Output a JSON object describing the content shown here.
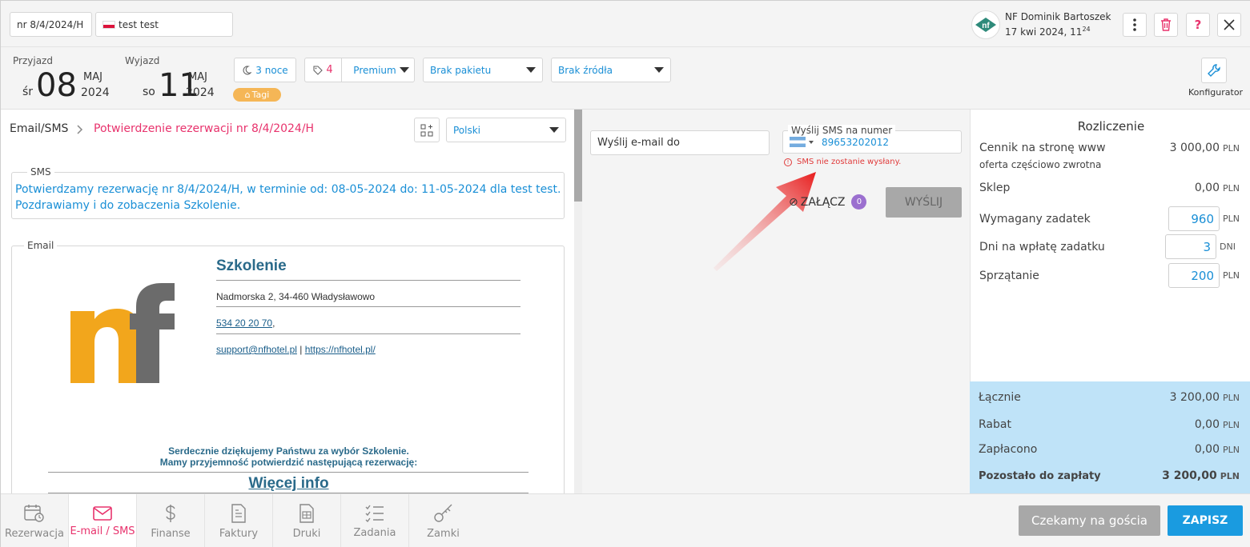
{
  "header": {
    "reservation_no": "nr 8/4/2024/H",
    "guest_name": "test test",
    "user_name": "NF Dominik Bartoszek",
    "user_date": "17 kwi 2024, 11",
    "user_time_sup": "24"
  },
  "stay": {
    "arrival_label": "Przyjazd",
    "arrival_weekday": "śr",
    "arrival_day": "08",
    "arrival_month": "MAJ",
    "arrival_year": "2024",
    "departure_label": "Wyjazd",
    "departure_weekday": "so",
    "departure_day": "11",
    "departure_month": "MAJ",
    "departure_year": "2024",
    "nights": "3 noce",
    "tag_count": "4",
    "rate": "Premium",
    "package": "Brak pakietu",
    "source": "Brak źródła",
    "tags_label": "Tagi",
    "configurator_label": "Konfigurator"
  },
  "breadcrumb": {
    "section": "Email/SMS",
    "current": "Potwierdzenie rezerwacji nr 8/4/2024/H",
    "language": "Polski"
  },
  "sms": {
    "legend": "SMS",
    "text_line1": "Potwierdzamy rezerwację nr 8/4/2024/H, w terminie od: 08-05-2024 do: 11-05-2024 dla test test.",
    "text_line2": "Pozdrawiamy i do zobaczenia Szkolenie."
  },
  "email": {
    "legend": "Email",
    "hotel_name": "Szkolenie",
    "address": "Nadmorska 2, 34-460 Władysławowo",
    "phone": "534 20 20 70",
    "phone_suffix": ",",
    "support_email": "support@nfhotel.pl",
    "separator": "|",
    "website": "https://nfhotel.pl/",
    "thanks_line1": "Serdecznie dziękujemy Państwu za wybór Szkolenie.",
    "thanks_line2": "Mamy przyjemność potwierdzić następującą rezerwację:",
    "more_info": "Więcej info"
  },
  "send": {
    "email_placeholder": "Wyślij e-mail do",
    "sms_label": "Wyślij SMS na numer",
    "sms_number": "89653202012",
    "sms_error": "SMS nie zostanie wysłany.",
    "attach_label": "ZAŁĄCZ",
    "attach_count": "0",
    "send_button": "WYŚLIJ"
  },
  "settlement": {
    "title": "Rozliczenie",
    "price_list_label": "Cennik na stronę www",
    "price_list_sub": "oferta częściowo zwrotna",
    "price_list_value": "3 000,00",
    "shop_label": "Sklep",
    "shop_value": "0,00",
    "deposit_label": "Wymagany zadatek",
    "deposit_value": "960",
    "deposit_days_label": "Dni na wpłatę zadatku",
    "deposit_days_value": "3",
    "days_unit": "DNI",
    "cleaning_label": "Sprzątanie",
    "cleaning_value": "200",
    "currency": "PLN",
    "total_label": "Łącznie",
    "total_value": "3 200,00",
    "discount_label": "Rabat",
    "discount_value": "0,00",
    "paid_label": "Zapłacono",
    "paid_value": "0,00",
    "remaining_label": "Pozostało do zapłaty",
    "remaining_value": "3 200,00"
  },
  "tabs": [
    {
      "label": "Rezerwacja",
      "icon": "calendar-clock-icon"
    },
    {
      "label": "E-mail / SMS",
      "icon": "envelope-icon"
    },
    {
      "label": "Finanse",
      "icon": "dollar-icon"
    },
    {
      "label": "Faktury",
      "icon": "invoice-icon"
    },
    {
      "label": "Druki",
      "icon": "print-document-icon"
    },
    {
      "label": "Zadania",
      "icon": "checklist-icon"
    },
    {
      "label": "Zamki",
      "icon": "key-icon"
    }
  ],
  "footer": {
    "waiting_button": "Czekamy na gościa",
    "save_button": "ZAPISZ"
  },
  "colors": {
    "accent": "#1a8fd6",
    "pink": "#e8336d",
    "summary_bg": "#bfe3f8",
    "logo_orange": "#f2a61c",
    "logo_gray": "#6b6b6b"
  }
}
